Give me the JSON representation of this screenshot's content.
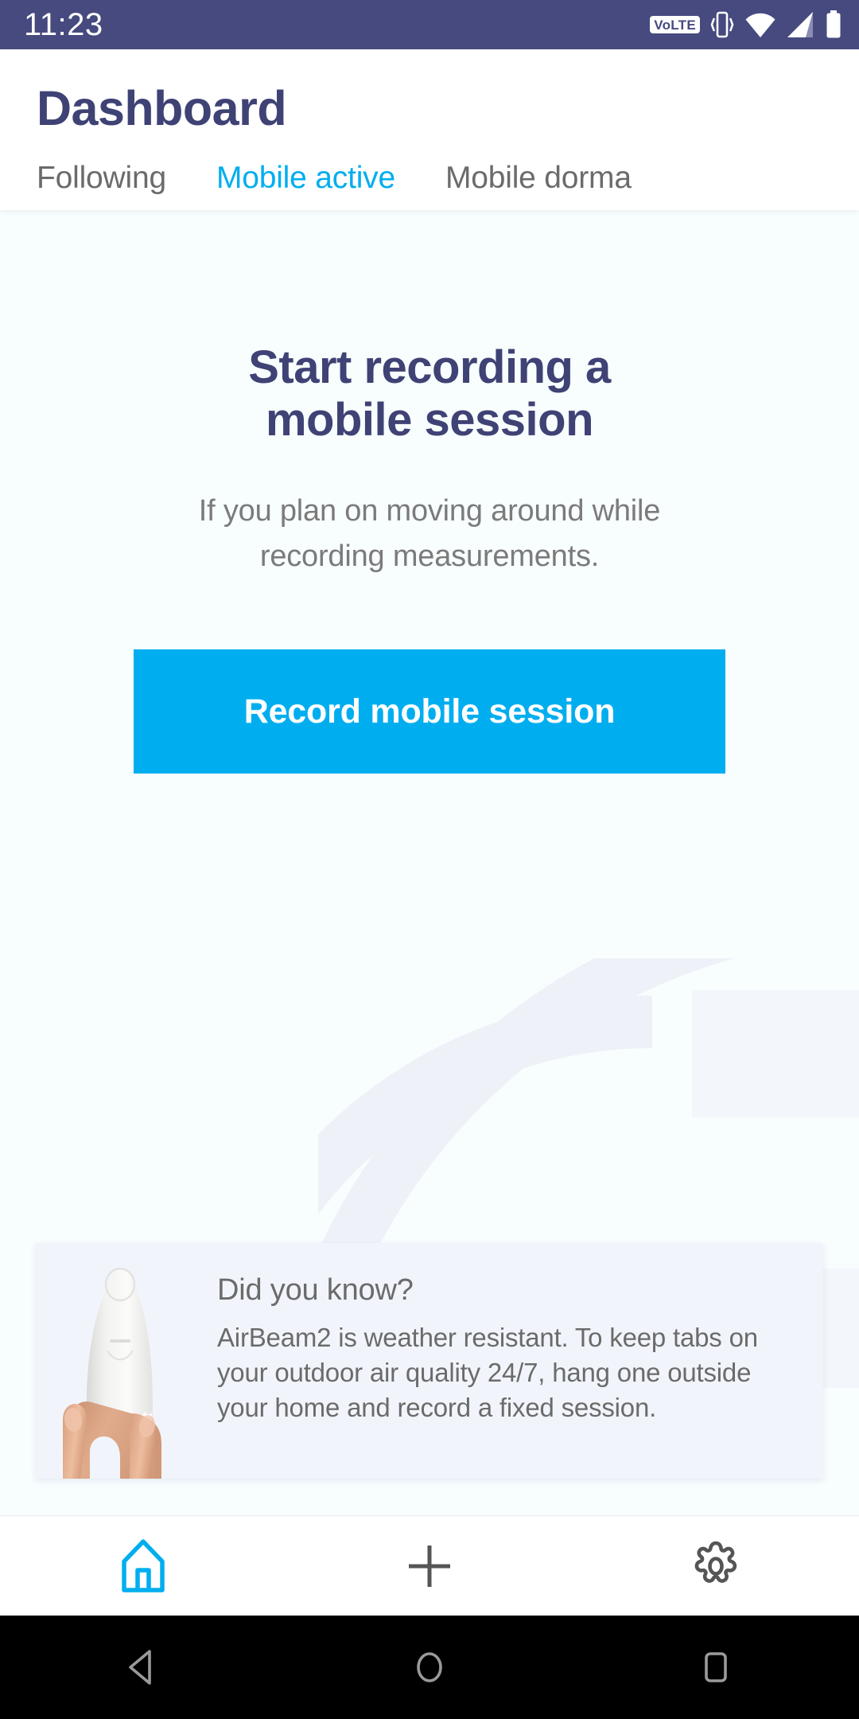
{
  "status_bar": {
    "time": "11:23",
    "volte_label": "VoLTE",
    "icons": [
      "volte-badge",
      "vibrate-icon",
      "wifi-icon",
      "cellular-signal-icon",
      "battery-icon"
    ],
    "background_color": "#474a7f"
  },
  "header": {
    "title": "Dashboard",
    "tabs": [
      {
        "label": "Following",
        "active": false
      },
      {
        "label": "Mobile active",
        "active": true
      },
      {
        "label": "Mobile dorma",
        "active": false
      }
    ],
    "active_tab_color": "#00aeef",
    "inactive_tab_color": "#6b6b6b",
    "title_color": "#3f4274"
  },
  "main": {
    "empty_state": {
      "title": "Start recording a mobile session",
      "subtitle": "If you plan on moving around while recording measurements.",
      "button_label": "Record mobile session",
      "button_color": "#00aeef"
    },
    "did_you_know": {
      "title": "Did you know?",
      "body": "AirBeam2 is weather resistant. To keep tabs on your outdoor air quality 24/7, hang one outside your home and record a fixed session.",
      "image_alt": "hand-holding-airbeam2-device",
      "card_color": "#f1f5fb"
    },
    "background_color": "#f8fdfe"
  },
  "bottom_nav": {
    "items": [
      {
        "icon": "home-icon",
        "active": true,
        "color": "#00aeef"
      },
      {
        "icon": "plus-icon",
        "active": false,
        "color": "#555555"
      },
      {
        "icon": "gear-icon",
        "active": false,
        "color": "#555555"
      }
    ]
  },
  "android_nav": {
    "items": [
      {
        "icon": "back-triangle-icon"
      },
      {
        "icon": "home-circle-icon"
      },
      {
        "icon": "recents-square-icon"
      }
    ],
    "background_color": "#000000"
  }
}
